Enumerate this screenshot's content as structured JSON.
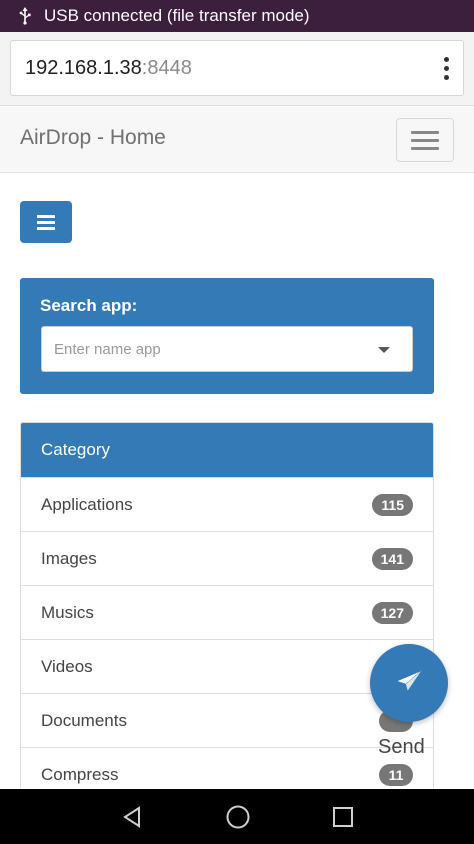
{
  "status_bar": {
    "text": "USB connected (file transfer mode)"
  },
  "url_bar": {
    "host": "192.168.1.38",
    "port": ":8448"
  },
  "navbar": {
    "brand": "AirDrop - Home"
  },
  "search": {
    "label": "Search app:",
    "placeholder": "Enter name app"
  },
  "category": {
    "title": "Category",
    "items": [
      {
        "label": "Applications",
        "count": "115"
      },
      {
        "label": "Images",
        "count": "141"
      },
      {
        "label": "Musics",
        "count": "127"
      },
      {
        "label": "Videos",
        "count": ""
      },
      {
        "label": "Documents",
        "count": ""
      },
      {
        "label": "Compress",
        "count": "11"
      }
    ]
  },
  "fab": {
    "label": "Send"
  },
  "colors": {
    "primary": "#337ab7",
    "status_bar": "#3c1e3d",
    "badge": "#777777"
  }
}
